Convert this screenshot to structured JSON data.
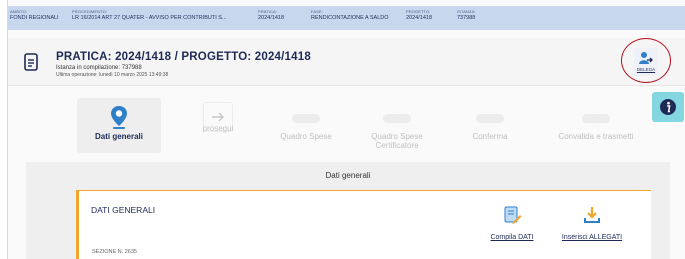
{
  "breadcrumb": [
    {
      "label": "AMBITO:",
      "value": "FONDI REGIONALI"
    },
    {
      "label": "PROCEDIMENTO:",
      "value": "LR 16/2014 ART 27 QUATER - AVVISO PER CONTRIBUTI S..."
    },
    {
      "label": "PRATICA:",
      "value": "2024/1418"
    },
    {
      "label": "FASE:",
      "value": "RENDICONTAZIONE A SALDO"
    },
    {
      "label": "PROGETTO:",
      "value": "2024/1418"
    },
    {
      "label": "ISTANZA:",
      "value": "737988"
    }
  ],
  "header": {
    "title": "PRATICA: 2024/1418  /  PROGETTO: 2024/1418",
    "status": "Istanza in compilazione: 737988",
    "last_operation": "Ultima operazione: lunedì 10 marzo 2025 13:49:38",
    "delega_label": "DELEGA"
  },
  "steps": [
    {
      "label": "Dati generali",
      "state": "active",
      "icon": "map-pin-icon"
    },
    {
      "label": "prosegui",
      "state": "next",
      "icon": "arrow-right-icon"
    },
    {
      "label": "Quadro Spese",
      "state": "pending"
    },
    {
      "label": "Quadro Spese Certificatore",
      "state": "pending"
    },
    {
      "label": "Conferma",
      "state": "pending"
    },
    {
      "label": "Convalida e trasmetti",
      "state": "pending"
    }
  ],
  "section": {
    "panel_title": "Dati generali",
    "card_title": "DATI GENERALI",
    "section_number": "SEZIONE N. 2635",
    "actions": [
      {
        "label": "Compila DATI",
        "icon": "edit-document-icon"
      },
      {
        "label": "Inserisci ALLEGATI",
        "icon": "download-icon"
      }
    ]
  },
  "colors": {
    "accent_blue": "#2f80c8",
    "brand_navy": "#1e2a55",
    "card_border": "#f0a52c",
    "info_button": "#84d7e0",
    "highlight_ring": "#b5101a"
  }
}
